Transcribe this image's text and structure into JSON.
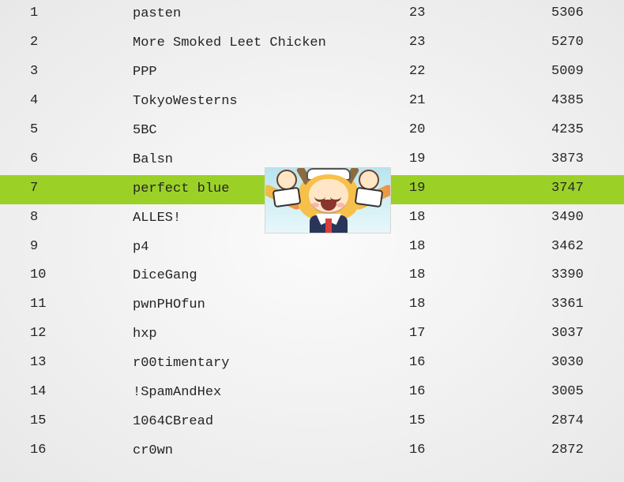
{
  "highlight_rank": 7,
  "highlight_color": "#9bd127",
  "rows": [
    {
      "rank": "1",
      "team": "pasten",
      "col3": "23",
      "score": "5306"
    },
    {
      "rank": "2",
      "team": "More Smoked Leet Chicken",
      "col3": "23",
      "score": "5270"
    },
    {
      "rank": "3",
      "team": "PPP",
      "col3": "22",
      "score": "5009"
    },
    {
      "rank": "4",
      "team": "TokyoWesterns",
      "col3": "21",
      "score": "4385"
    },
    {
      "rank": "5",
      "team": "5BC",
      "col3": "20",
      "score": "4235"
    },
    {
      "rank": "6",
      "team": "Balsn",
      "col3": "19",
      "score": "3873"
    },
    {
      "rank": "7",
      "team": "perfect blue",
      "col3": "19",
      "score": "3747"
    },
    {
      "rank": "8",
      "team": "ALLES!",
      "col3": "18",
      "score": "3490"
    },
    {
      "rank": "9",
      "team": "p4",
      "col3": "18",
      "score": "3462"
    },
    {
      "rank": "10",
      "team": "DiceGang",
      "col3": "18",
      "score": "3390"
    },
    {
      "rank": "11",
      "team": "pwnPHOfun",
      "col3": "18",
      "score": "3361"
    },
    {
      "rank": "12",
      "team": "hxp",
      "col3": "17",
      "score": "3037"
    },
    {
      "rank": "13",
      "team": "r00timentary",
      "col3": "16",
      "score": "3030"
    },
    {
      "rank": "14",
      "team": "!SpamAndHex",
      "col3": "16",
      "score": "3005"
    },
    {
      "rank": "15",
      "team": "1064CBread",
      "col3": "15",
      "score": "2874"
    },
    {
      "rank": "16",
      "team": "cr0wn",
      "col3": "16",
      "score": "2872"
    }
  ]
}
